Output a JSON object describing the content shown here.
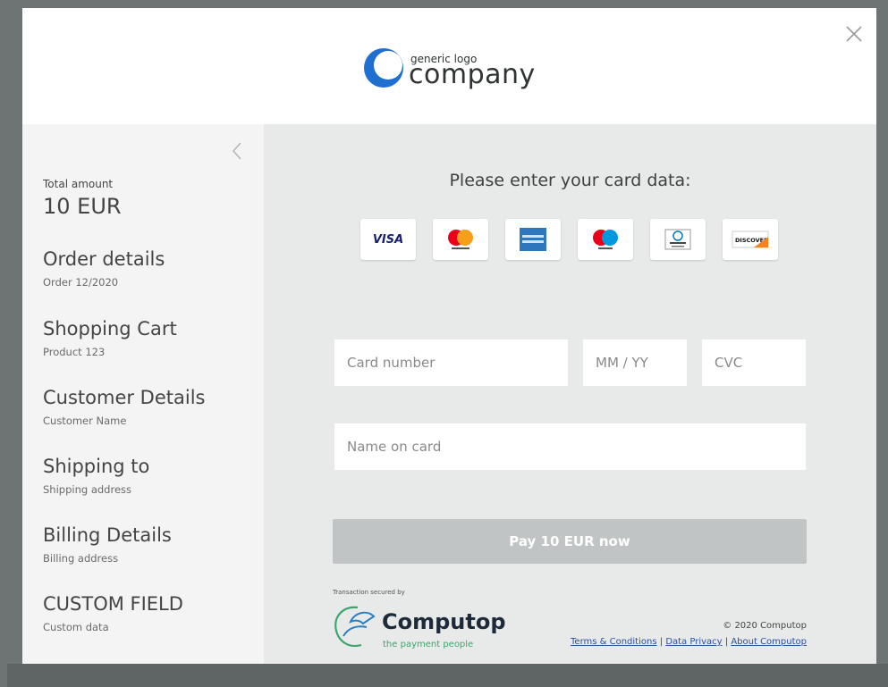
{
  "header": {
    "logo_small": "generic logo",
    "logo_big": "company"
  },
  "sidebar": {
    "total_label": "Total amount",
    "total_value": "10 EUR",
    "sections": [
      {
        "title": "Order details",
        "sub": "Order 12/2020"
      },
      {
        "title": "Shopping Cart",
        "sub": "Product 123"
      },
      {
        "title": "Customer Details",
        "sub": "Customer Name"
      },
      {
        "title": "Shipping to",
        "sub": "Shipping address"
      },
      {
        "title": "Billing Details",
        "sub": "Billing address"
      },
      {
        "title": "CUSTOM FIELD",
        "sub": "Custom data"
      }
    ]
  },
  "main": {
    "heading": "Please enter your card data:",
    "card_brands": [
      "visa",
      "mastercard",
      "american-express",
      "maestro",
      "diners-club",
      "discover"
    ],
    "visa_text": "VISA",
    "discover_text": "DISCOVER",
    "inputs": {
      "card_number": "Card number",
      "expiry": "MM / YY",
      "cvc": "CVC",
      "name": "Name on card"
    },
    "pay_label": "Pay 10 EUR now",
    "secured_by": "Transaction secured by",
    "provider_name": "Computop",
    "provider_tagline": "the payment people",
    "copyright": "© 2020 Computop",
    "links": [
      "Terms & Conditions",
      "Data Privacy",
      "About Computop"
    ],
    "link_separator": "|"
  },
  "colors": {
    "overlay": "#6e7473",
    "sidebar_bg": "#f4f4f4",
    "main_bg": "#e8eaea",
    "pay_button": "#c1c4c4",
    "logo_blue": "#1f6fd1",
    "link": "#2a4fa0"
  }
}
